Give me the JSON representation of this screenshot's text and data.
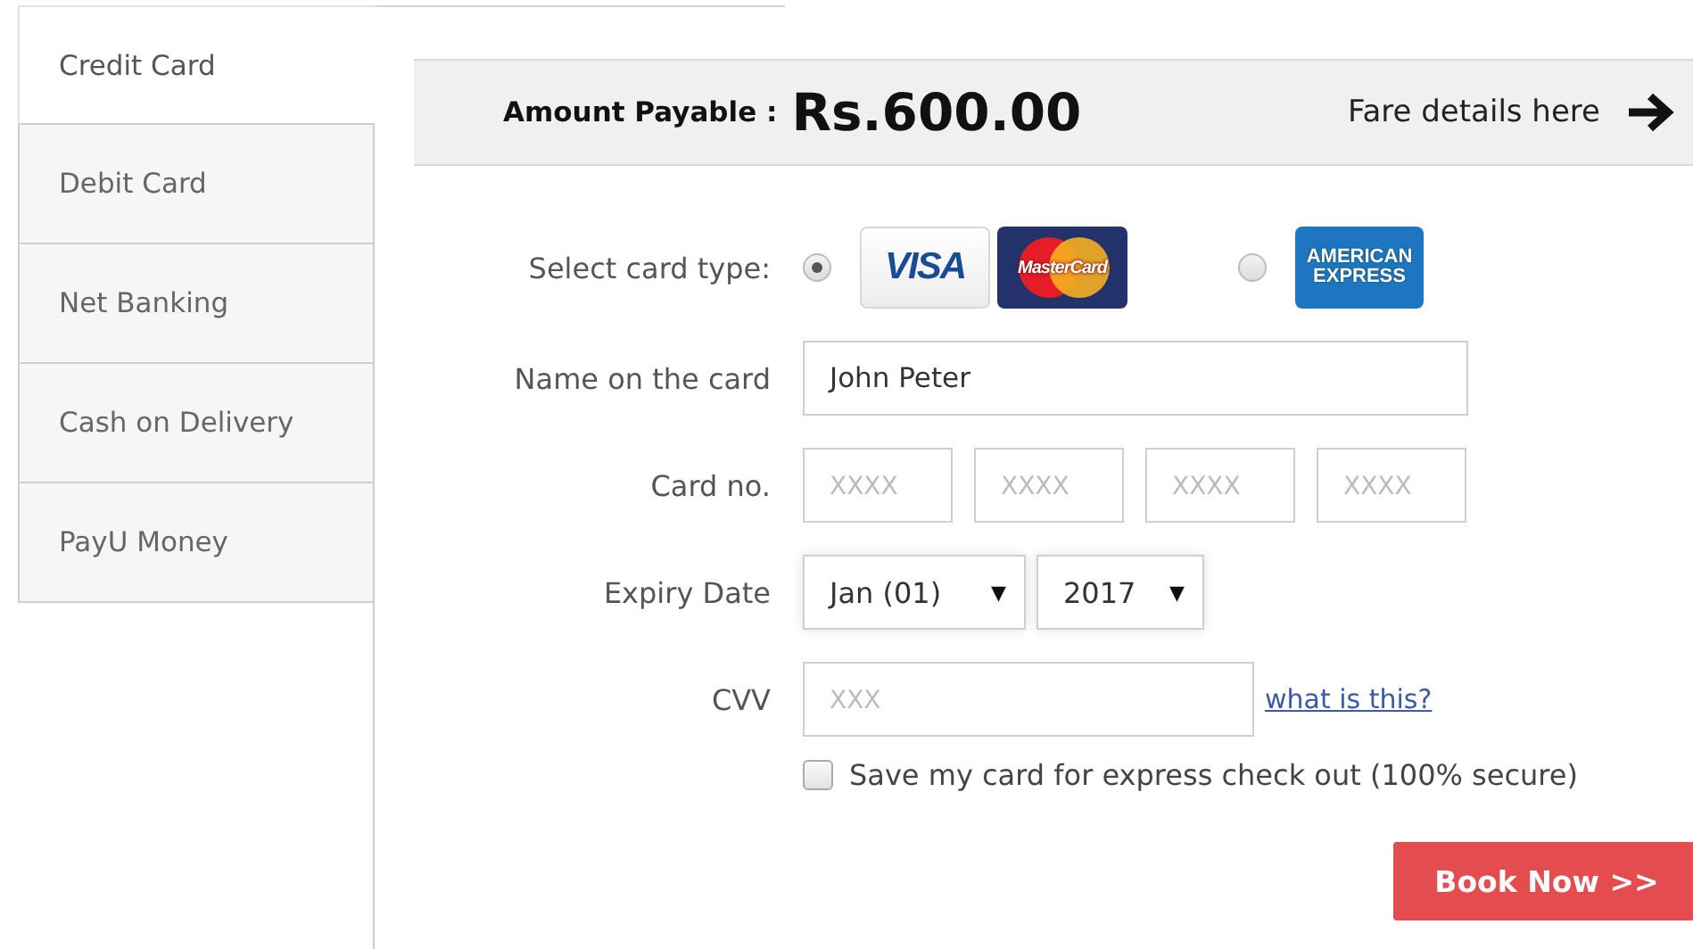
{
  "tabs": [
    {
      "label": "Credit Card",
      "selected": true
    },
    {
      "label": "Debit Card",
      "selected": false
    },
    {
      "label": "Net Banking",
      "selected": false
    },
    {
      "label": "Cash on Delivery",
      "selected": false
    },
    {
      "label": "PayU Money",
      "selected": false
    }
  ],
  "amount_bar": {
    "label": "Amount Payable :",
    "amount": "Rs.600.00",
    "fare_link": "Fare details here"
  },
  "card_type": {
    "label": "Select card type:",
    "options": [
      {
        "selected": true,
        "logos": [
          {
            "kind": "visa",
            "text": "VISA"
          },
          {
            "kind": "mastercard",
            "text": "MasterCard"
          }
        ]
      },
      {
        "selected": false,
        "logos": [
          {
            "kind": "amex",
            "text": "AMERICAN EXPRESS"
          }
        ]
      }
    ]
  },
  "name_on_card": {
    "label": "Name on the card",
    "value": "John Peter"
  },
  "card_no": {
    "label": "Card no.",
    "parts": [
      {
        "placeholder": "XXXX"
      },
      {
        "placeholder": "XXXX"
      },
      {
        "placeholder": "XXXX"
      },
      {
        "placeholder": "XXXX"
      }
    ]
  },
  "expiry": {
    "label": "Expiry Date",
    "month": "Jan (01)",
    "year": "2017",
    "arrow": "▼"
  },
  "cvv": {
    "label": "CVV",
    "placeholder": "XXX",
    "help_link": "what is this?"
  },
  "save_card": {
    "label": "Save my card for express check out (100% secure)",
    "checked": false
  },
  "book_button": "Book Now >>"
}
